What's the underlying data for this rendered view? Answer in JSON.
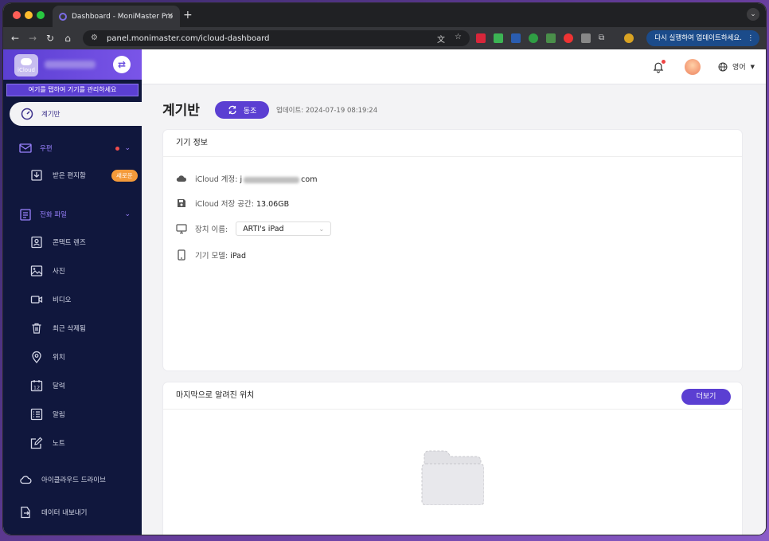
{
  "browser": {
    "tab_title": "Dashboard - MoniMaster Pro",
    "url": "panel.monimaster.com/icloud-dashboard",
    "update_button": "다시 실행하여 업데이트하세요."
  },
  "sidebar": {
    "icloud_label": "iCloud",
    "tooltip": "여기를 탭하여 기기를 관리하세요",
    "active_item": "계기반",
    "mail_group": "우편",
    "inbox": "받은 편지함",
    "inbox_badge": "새로운",
    "phone_files_group": "전화 파일",
    "items": [
      {
        "label": "콘택트 렌즈",
        "icon": "contacts-icon"
      },
      {
        "label": "사진",
        "icon": "photo-icon"
      },
      {
        "label": "비디오",
        "icon": "video-icon"
      },
      {
        "label": "최근 삭제됨",
        "icon": "trash-icon"
      },
      {
        "label": "위치",
        "icon": "location-icon"
      },
      {
        "label": "달력",
        "icon": "calendar-icon"
      },
      {
        "label": "알림",
        "icon": "reminder-icon"
      },
      {
        "label": "노트",
        "icon": "note-icon"
      }
    ],
    "icloud_drive": "아이클라우드 드라이브",
    "export": "데이터 내보내기"
  },
  "topbar": {
    "language": "영어"
  },
  "main": {
    "title": "계기반",
    "sync_label": "동조",
    "updated": "업데이트: 2024-07-19 08:19:24",
    "device_card": {
      "title": "기기 정보",
      "account_label": "iCloud 계정:",
      "account_prefix": "j",
      "account_suffix": "com",
      "storage_label": "iCloud 저장 공간:",
      "storage_value": "13.06GB",
      "device_name_label": "장치 이름:",
      "device_name_value": "ARTI's iPad",
      "model_label": "기기 모델:",
      "model_value": "iPad"
    },
    "location_card": {
      "title": "마지막으로 알려진 위치",
      "more": "더보기"
    }
  }
}
